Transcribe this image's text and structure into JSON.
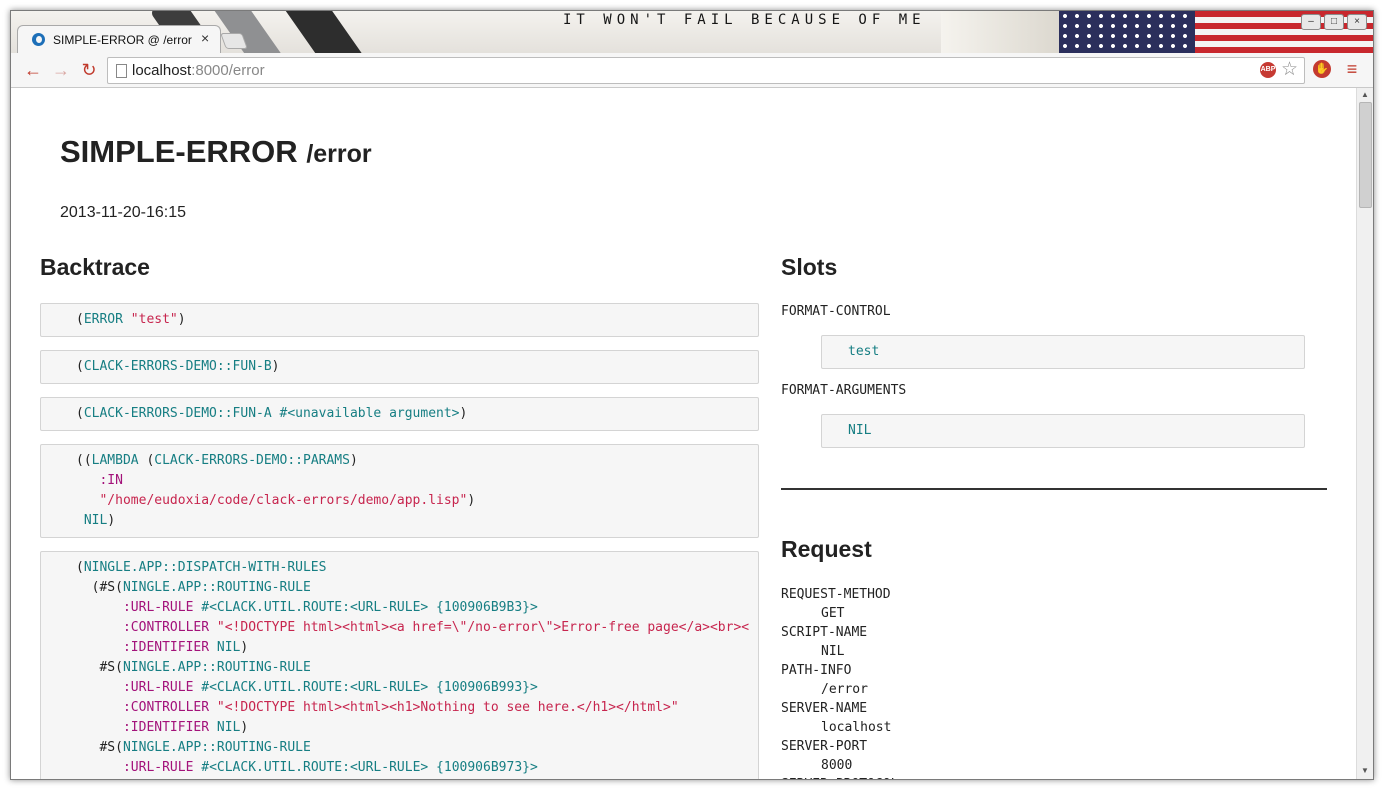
{
  "browser": {
    "tab_title": "SIMPLE-ERROR @ /error",
    "tab_close": "×",
    "url_host": "localhost",
    "url_rest": ":8000/error",
    "wallpaper_text": "IT WON'T FAIL BECAUSE OF ME",
    "icons": {
      "favicon": "d-logo-icon",
      "back": "back-arrow-icon",
      "forward": "forward-arrow-icon",
      "reload": "reload-icon",
      "adblock": "abp-icon",
      "bookmark": "star-icon",
      "extension": "stop-hand-icon",
      "menu": "menu-icon"
    },
    "accent_color": "#c0392b"
  },
  "page": {
    "title": "SIMPLE-ERROR",
    "title_path": "/error",
    "timestamp": "2013-11-20-16:15",
    "backtrace_heading": "Backtrace",
    "slots_heading": "Slots",
    "request_heading": "Request"
  },
  "backtrace": {
    "frame1": {
      "open": "(",
      "fn": "ERROR",
      "sp": " ",
      "arg": "\"test\"",
      "close": ")"
    },
    "frame2": {
      "open": "(",
      "fn": "CLACK-ERRORS-DEMO::FUN-B",
      "close": ")"
    },
    "frame3": {
      "open": "(",
      "fn": "CLACK-ERRORS-DEMO::FUN-A",
      "sp": " ",
      "arg": "#<unavailable argument>",
      "close": ")"
    },
    "frame4": {
      "l1_open": "((",
      "l1_lambda": "LAMBDA",
      "l1_mid": " (",
      "l1_params": "CLACK-ERRORS-DEMO::PARAMS",
      "l1_close": ")",
      "l2_indent": "   ",
      "l2_kw": ":IN",
      "l3_indent": "   ",
      "l3_str": "\"/home/eudoxia/code/clack-errors/demo/app.lisp\"",
      "l3_close": ")",
      "l4_indent": " ",
      "l4_nil": "NIL",
      "l4_close": ")"
    },
    "frame5": {
      "l1_open": "(",
      "l1_fn": "NINGLE.APP::DISPATCH-WITH-RULES",
      "l2_open": "  (#S(",
      "l2_rule": "NINGLE.APP::ROUTING-RULE",
      "r1_urlrule_kw": ":URL-RULE",
      "r1_urlrule_val": "#<CLACK.UTIL.ROUTE:<URL-RULE> {100906B9B3}>",
      "r1_controller_kw": ":CONTROLLER",
      "r1_controller_val": "\"<!DOCTYPE html><html><a href=\\\"/no-error\\\">Error-free page</a><br><",
      "r1_identifier_kw": ":IDENTIFIER",
      "r1_identifier_val": "NIL",
      "r1_close": ")",
      "r2_open": "   #S(",
      "r2_rule": "NINGLE.APP::ROUTING-RULE",
      "r2_urlrule_kw": ":URL-RULE",
      "r2_urlrule_val": "#<CLACK.UTIL.ROUTE:<URL-RULE> {100906B993}>",
      "r2_controller_kw": ":CONTROLLER",
      "r2_controller_val": "\"<!DOCTYPE html><html><h1>Nothing to see here.</h1></html>\"",
      "r2_identifier_kw": ":IDENTIFIER",
      "r2_identifier_val": "NIL",
      "r2_close": ")",
      "r3_open": "   #S(",
      "r3_rule": "NINGLE.APP::ROUTING-RULE",
      "r3_urlrule_kw": ":URL-RULE",
      "r3_urlrule_val": "#<CLACK.UTIL.ROUTE:<URL-RULE> {100906B973}>",
      "indent_kw": "      ",
      "sp": " "
    }
  },
  "slots": [
    {
      "name": "FORMAT-CONTROL",
      "value": "test"
    },
    {
      "name": "FORMAT-ARGUMENTS",
      "value": "NIL"
    }
  ],
  "request": [
    {
      "key": "REQUEST-METHOD",
      "value": "GET"
    },
    {
      "key": "SCRIPT-NAME",
      "value": "NIL"
    },
    {
      "key": "PATH-INFO",
      "value": "/error"
    },
    {
      "key": "SERVER-NAME",
      "value": "localhost"
    },
    {
      "key": "SERVER-PORT",
      "value": "8000"
    },
    {
      "key": "SERVER-PROTOCOL",
      "value": ""
    }
  ],
  "colors": {
    "symbol": "#167e83",
    "string": "#c7254e",
    "keyword": "#a3127a",
    "code_background": "#f6f6f6"
  }
}
